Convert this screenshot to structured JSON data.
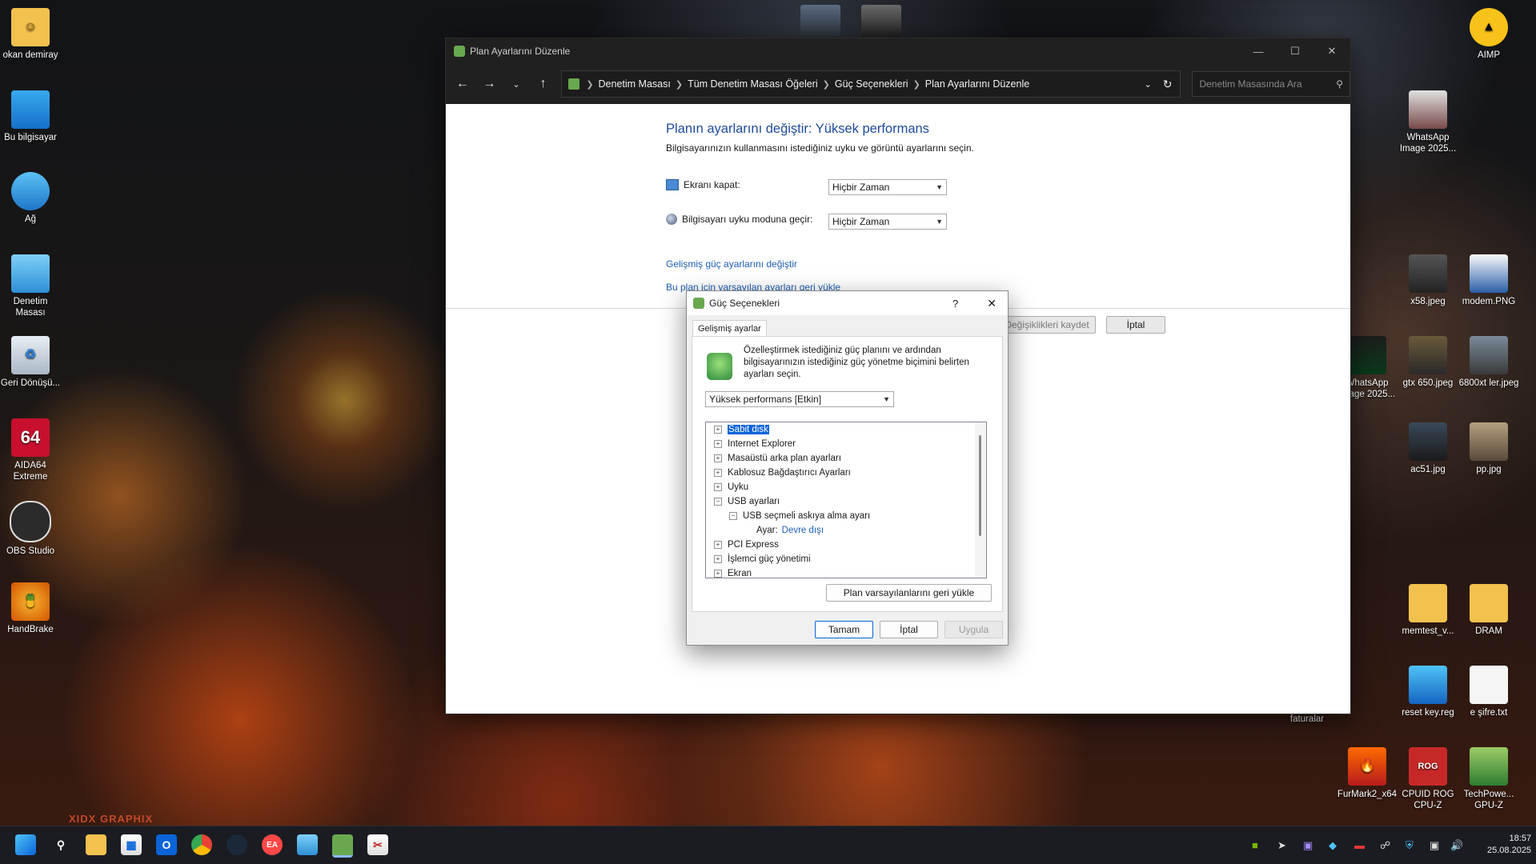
{
  "desktop": {
    "left_icons": [
      {
        "label": "okan demiray"
      },
      {
        "label": "Bu bilgisayar"
      },
      {
        "label": "Ağ"
      },
      {
        "label": "Denetim Masası"
      },
      {
        "label": "Geri Dönüşü..."
      },
      {
        "label": "AIDA64 Extreme"
      },
      {
        "label": "OBS Studio"
      },
      {
        "label": "HandBrake"
      }
    ],
    "right_icons": [
      {
        "label": "AIMP"
      },
      {
        "label": "WhatsApp Image 2025..."
      },
      {
        "label": "x58.jpeg"
      },
      {
        "label": "modem.PNG"
      },
      {
        "label": "WhatsApp Image 2025..."
      },
      {
        "label": "gtx 650.jpeg"
      },
      {
        "label": "6800xt ler.jpeg"
      },
      {
        "label": "ac51.jpg"
      },
      {
        "label": "pp.jpg"
      },
      {
        "label": "memtest_v..."
      },
      {
        "label": "DRAM"
      },
      {
        "label": "anakart faturalar"
      },
      {
        "label": "reset key.reg"
      },
      {
        "label": "e şifre.txt"
      },
      {
        "label": "FurMark2_x64"
      },
      {
        "label": "CPUID ROG CPU-Z"
      },
      {
        "label": "TechPowe... GPU-Z"
      }
    ],
    "watermark": "XIDX GRAPHIX"
  },
  "window": {
    "title": "Plan Ayarlarını Düzenle",
    "breadcrumb": [
      "Denetim Masası",
      "Tüm Denetim Masası Öğeleri",
      "Güç Seçenekleri",
      "Plan Ayarlarını Düzenle"
    ],
    "search_placeholder": "Denetim Masasında Ara",
    "heading": "Planın ayarlarını değiştir: Yüksek performans",
    "subheading": "Bilgisayarınızın kullanmasını istediğiniz uyku ve görüntü ayarlarını seçin.",
    "display_off_label": "Ekranı kapat:",
    "display_off_value": "Hiçbir Zaman",
    "sleep_label": "Bilgisayarı uyku moduna geçir:",
    "sleep_value": "Hiçbir Zaman",
    "advanced_link": "Gelişmiş güç ayarlarını değiştir",
    "restore_link": "Bu plan için varsayılan ayarları geri yükle",
    "save_button": "Değişiklikleri kaydet",
    "cancel_button": "İptal"
  },
  "dialog": {
    "title": "Güç Seçenekleri",
    "help": "?",
    "tab": "Gelişmiş ayarlar",
    "description": "Özelleştirmek istediğiniz güç planını ve ardından bilgisayarınızın istediğiniz güç yönetme biçimini belirten ayarları seçin.",
    "plan_select": "Yüksek performans [Etkin]",
    "tree": [
      {
        "label": "Sabit disk",
        "expander": "+",
        "level": 0,
        "selected": true
      },
      {
        "label": "Internet Explorer",
        "expander": "+",
        "level": 0
      },
      {
        "label": "Masaüstü arka plan ayarları",
        "expander": "+",
        "level": 0
      },
      {
        "label": "Kablosuz Bağdaştırıcı Ayarları",
        "expander": "+",
        "level": 0
      },
      {
        "label": "Uyku",
        "expander": "+",
        "level": 0
      },
      {
        "label": "USB ayarları",
        "expander": "−",
        "level": 0
      },
      {
        "label": "USB seçmeli askıya alma ayarı",
        "expander": "−",
        "level": 1
      },
      {
        "label": "Ayar:",
        "value": "Devre dışı",
        "level": 2
      },
      {
        "label": "PCI Express",
        "expander": "+",
        "level": 0
      },
      {
        "label": "İşlemci güç yönetimi",
        "expander": "+",
        "level": 0
      },
      {
        "label": "Ekran",
        "expander": "+",
        "level": 0
      }
    ],
    "restore_button": "Plan varsayılanlarını geri yükle",
    "ok_button": "Tamam",
    "cancel_button": "İptal",
    "apply_button": "Uygula"
  },
  "taskbar": {
    "apps": [
      "start-icon",
      "search-icon",
      "file-explorer-icon",
      "store-icon",
      "outlook-icon",
      "chrome-icon",
      "steam-icon",
      "ea-icon",
      "control-panel-icon",
      "power-options-icon",
      "snip-icon"
    ],
    "clock_time": "18:57",
    "clock_date": "25.08.2025"
  }
}
